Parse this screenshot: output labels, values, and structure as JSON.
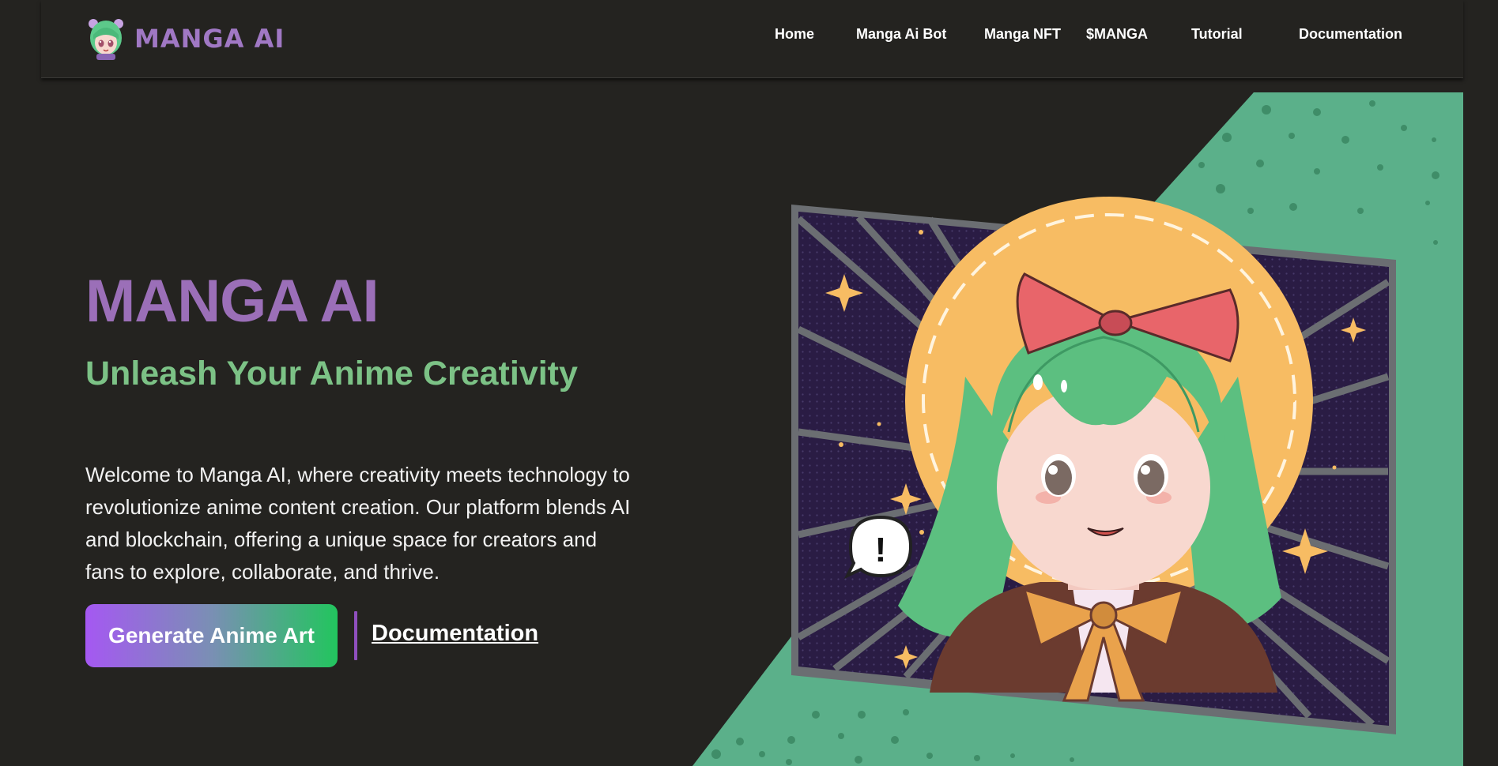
{
  "brand": {
    "logo_text": "MANGA AI"
  },
  "nav": {
    "items": [
      {
        "label": "Home"
      },
      {
        "label": "Manga Ai Bot"
      },
      {
        "label": "Manga NFT"
      },
      {
        "label": "$MANGA"
      },
      {
        "label": "Tutorial"
      },
      {
        "label": "Documentation"
      }
    ]
  },
  "hero": {
    "title": "MANGA AI",
    "subtitle": "Unleash Your Anime Creativity",
    "description": "Welcome to Manga AI, where creativity meets technology to revolutionize anime content creation. Our platform blends AI and blockchain, offering a unique space for creators and fans to explore, collaborate, and thrive.",
    "primary_button": "Generate Anime Art",
    "secondary_link": "Documentation"
  },
  "speech_bubble": {
    "text": "!"
  },
  "colors": {
    "background": "#242320",
    "brand_purple": "#9b6fb8",
    "subtitle_green": "#7cc286",
    "panel_green": "#5bb08a",
    "gradient_start": "#a558f2",
    "gradient_end": "#22c55e"
  },
  "icons": {
    "logo": "anime-girl-avatar-icon",
    "art": "anime-girl-illustration"
  }
}
